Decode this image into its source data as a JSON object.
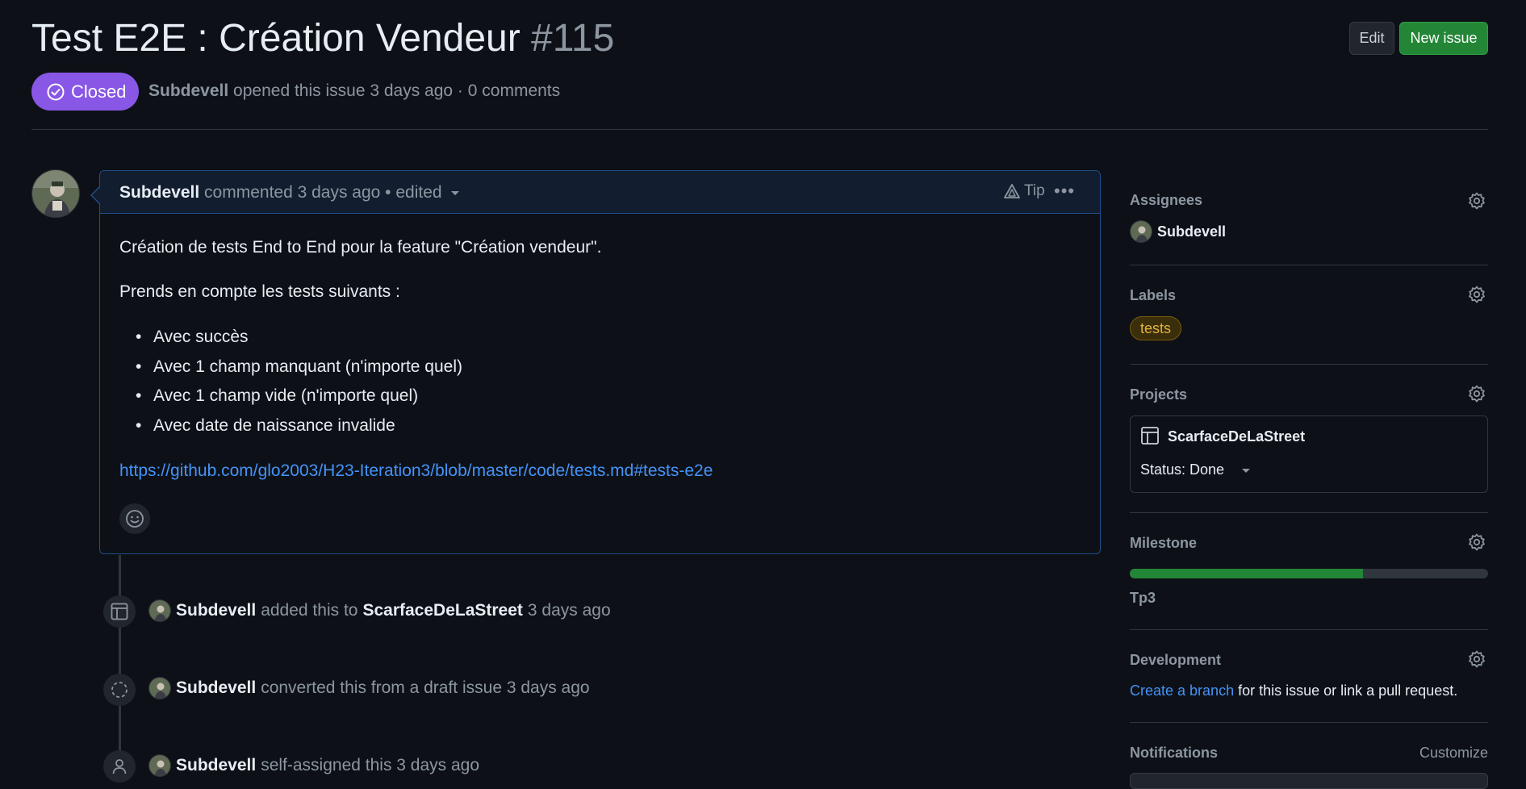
{
  "issue": {
    "title": "Test E2E : Création Vendeur",
    "number": "#115",
    "state": "Closed",
    "author": "Subdevell",
    "opened_text": "opened this issue 3 days ago",
    "separator": "·",
    "comments_count": "0 comments"
  },
  "header_actions": {
    "edit_label": "Edit",
    "new_issue_label": "New issue"
  },
  "comment": {
    "author": "Subdevell",
    "meta": "commented 3 days ago • edited",
    "tip_label": "Tip",
    "more_label": "•••",
    "paragraph1": "Création de tests End to End pour la feature \"Création vendeur\".",
    "paragraph2": "Prends en compte les tests suivants :",
    "bullets": [
      "Avec succès",
      "Avec 1 champ manquant (n'importe quel)",
      "Avec 1 champ vide (n'importe quel)",
      "Avec date de naissance invalide"
    ],
    "link": "https://github.com/glo2003/H23-Iteration3/blob/master/code/tests.md#tests-e2e"
  },
  "timeline": [
    {
      "icon": "table-icon",
      "actor": "Subdevell",
      "pre": "added this to",
      "target": "ScarfaceDeLaStreet",
      "post": "3 days ago"
    },
    {
      "icon": "draft-icon",
      "actor": "Subdevell",
      "pre": "converted this from a draft issue 3 days ago",
      "target": "",
      "post": ""
    },
    {
      "icon": "person-icon",
      "actor": "Subdevell",
      "pre": "self-assigned this 3 days ago",
      "target": "",
      "post": ""
    }
  ],
  "sidebar": {
    "assignees": {
      "heading": "Assignees",
      "user": "Subdevell"
    },
    "labels": {
      "heading": "Labels",
      "label": "tests"
    },
    "projects": {
      "heading": "Projects",
      "project_name": "ScarfaceDeLaStreet",
      "status": "Status: Done"
    },
    "milestone": {
      "heading": "Milestone",
      "name": "Tp3",
      "progress_percent": 65
    },
    "development": {
      "heading": "Development",
      "link_text": "Create a branch",
      "rest_text": "for this issue or link a pull request."
    },
    "notifications": {
      "heading": "Notifications",
      "customize_label": "Customize"
    }
  },
  "colors": {
    "closed_badge": "#8957e5",
    "new_issue_button": "#238636",
    "link": "#4493f8",
    "label_tests": "#e3b341"
  }
}
